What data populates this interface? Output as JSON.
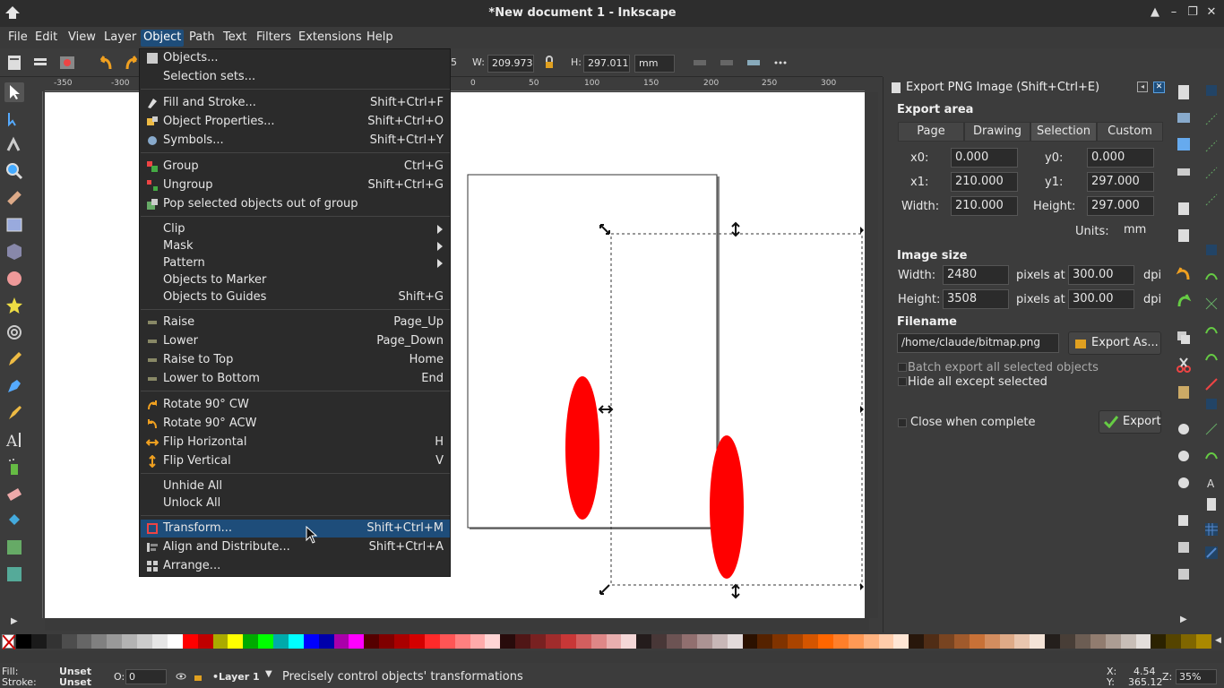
{
  "window": {
    "title": "*New document 1 - Inkscape"
  },
  "menubar": {
    "items": [
      "File",
      "Edit",
      "View",
      "Layer",
      "Object",
      "Path",
      "Text",
      "Filters",
      "Extensions",
      "Help"
    ],
    "active": "Object"
  },
  "toolbar": {
    "w_label": "W:",
    "w_value": "209.973",
    "h_label": "H:",
    "h_value": "297.011",
    "unit": "mm",
    "x_partial": "5"
  },
  "rulers": {
    "horizontal": [
      "-350",
      "-300",
      "0",
      "50",
      "100",
      "150",
      "200",
      "250",
      "300"
    ]
  },
  "object_menu": {
    "items": [
      {
        "label": "Objects...",
        "shortcut": "",
        "icon": "objects-icon"
      },
      {
        "label": "Selection sets...",
        "shortcut": "",
        "icon": ""
      },
      {
        "label": "Fill and Stroke...",
        "shortcut": "Shift+Ctrl+F",
        "icon": "fill-stroke-icon"
      },
      {
        "label": "Object Properties...",
        "shortcut": "Shift+Ctrl+O",
        "icon": "object-properties-icon"
      },
      {
        "label": "Symbols...",
        "shortcut": "Shift+Ctrl+Y",
        "icon": "symbols-icon"
      },
      {
        "label": "Group",
        "shortcut": "Ctrl+G",
        "icon": "group-icon"
      },
      {
        "label": "Ungroup",
        "shortcut": "Shift+Ctrl+G",
        "icon": "ungroup-icon"
      },
      {
        "label": "Pop selected objects out of group",
        "shortcut": "",
        "icon": "pop-out-icon"
      },
      {
        "label": "Clip",
        "shortcut": "",
        "icon": "",
        "submenu": true
      },
      {
        "label": "Mask",
        "shortcut": "",
        "icon": "",
        "submenu": true
      },
      {
        "label": "Pattern",
        "shortcut": "",
        "icon": "",
        "submenu": true
      },
      {
        "label": "Objects to Marker",
        "shortcut": "",
        "icon": ""
      },
      {
        "label": "Objects to Guides",
        "shortcut": "Shift+G",
        "icon": ""
      },
      {
        "label": "Raise",
        "shortcut": "Page_Up",
        "icon": "raise-icon"
      },
      {
        "label": "Lower",
        "shortcut": "Page_Down",
        "icon": "lower-icon"
      },
      {
        "label": "Raise to Top",
        "shortcut": "Home",
        "icon": "raise-top-icon"
      },
      {
        "label": "Lower to Bottom",
        "shortcut": "End",
        "icon": "lower-bottom-icon"
      },
      {
        "label": "Rotate 90° CW",
        "shortcut": "",
        "icon": "rotate-cw-icon"
      },
      {
        "label": "Rotate 90° ACW",
        "shortcut": "",
        "icon": "rotate-acw-icon"
      },
      {
        "label": "Flip Horizontal",
        "shortcut": "H",
        "icon": "flip-horizontal-icon"
      },
      {
        "label": "Flip Vertical",
        "shortcut": "V",
        "icon": "flip-vertical-icon"
      },
      {
        "label": "Unhide All",
        "shortcut": "",
        "icon": ""
      },
      {
        "label": "Unlock All",
        "shortcut": "",
        "icon": ""
      },
      {
        "label": "Transform...",
        "shortcut": "Shift+Ctrl+M",
        "icon": "transform-icon",
        "highlighted": true
      },
      {
        "label": "Align and Distribute...",
        "shortcut": "Shift+Ctrl+A",
        "icon": "align-icon"
      },
      {
        "label": "Arrange...",
        "shortcut": "",
        "icon": "arrange-icon"
      }
    ]
  },
  "export_dialog": {
    "title": "Export PNG Image (Shift+Ctrl+E)",
    "export_area_heading": "Export area",
    "tabs": [
      "Page",
      "Drawing",
      "Selection",
      "Custom"
    ],
    "selected_tab": "Selection",
    "x0_label": "x0:",
    "x0": "0.000",
    "y0_label": "y0:",
    "y0": "0.000",
    "x1_label": "x1:",
    "x1": "210.000",
    "y1_label": "y1:",
    "y1": "297.000",
    "width_label": "Width:",
    "width": "210.000",
    "height_label": "Height:",
    "height": "297.000",
    "units_label": "Units:",
    "units": "mm",
    "image_size_heading": "Image size",
    "img_width_label": "Width:",
    "img_width": "2480",
    "img_height_label": "Height:",
    "img_height": "3508",
    "pixels_at": "pixels at",
    "dpi_x": "300.00",
    "dpi_y": "300.00",
    "dpi": "dpi",
    "filename_heading": "Filename",
    "filename": "/home/claude/bitmap.png",
    "export_as": "Export As...",
    "batch_export": "Batch export all selected objects",
    "hide_all": "Hide all except selected",
    "close_when_complete": "Close when complete",
    "export": "Export"
  },
  "status": {
    "fill_label": "Fill:",
    "fill_value": "Unset",
    "stroke_label": "Stroke:",
    "stroke_value": "Unset",
    "opacity_label": "O:",
    "opacity_value": "0",
    "layer": "•Layer 1",
    "message": "Precisely control objects' transformations",
    "x_label": "X:",
    "x": "4.54",
    "y_label": "Y:",
    "y": "365.12",
    "zoom_label": "Z:",
    "zoom": "35%"
  },
  "palette": [
    "#000000",
    "#1a1a1a",
    "#333333",
    "#4d4d4d",
    "#666666",
    "#808080",
    "#999999",
    "#b3b3b3",
    "#cccccc",
    "#e6e6e6",
    "#ffffff",
    "#ff0000",
    "#c00000",
    "#aaaa00",
    "#ffff00",
    "#00aa00",
    "#00ff00",
    "#00aaaa",
    "#00ffff",
    "#0000ff",
    "#0000aa",
    "#aa00aa",
    "#ff00ff",
    "#550000",
    "#800000",
    "#aa0000",
    "#d40000",
    "#ff2a2a",
    "#ff5555",
    "#ff8080",
    "#ffaaaa",
    "#ffd5d5",
    "#280b0b",
    "#501616",
    "#782121",
    "#a02c2c",
    "#c83737",
    "#d35f5f",
    "#de8787",
    "#e9afaf",
    "#f4d7d7",
    "#241c1c",
    "#483737",
    "#6c5353",
    "#916f6f",
    "#ac9393",
    "#c8b7b7",
    "#e3dbdb",
    "#2b1100",
    "#552200",
    "#803300",
    "#aa4400",
    "#d45500",
    "#ff6600",
    "#ff7f2a",
    "#ff9955",
    "#ffb380",
    "#ffccaa",
    "#ffe6d5",
    "#28170b",
    "#502d16",
    "#784421",
    "#a05a2c",
    "#c87137",
    "#d38d5f",
    "#deaa87",
    "#e9c6af",
    "#f4e3d7",
    "#241f1c",
    "#483e37",
    "#6c5d53",
    "#917c6f",
    "#ac9d93",
    "#c8beb7",
    "#e3dedb",
    "#2b2200",
    "#554400",
    "#806600",
    "#aa8800"
  ]
}
